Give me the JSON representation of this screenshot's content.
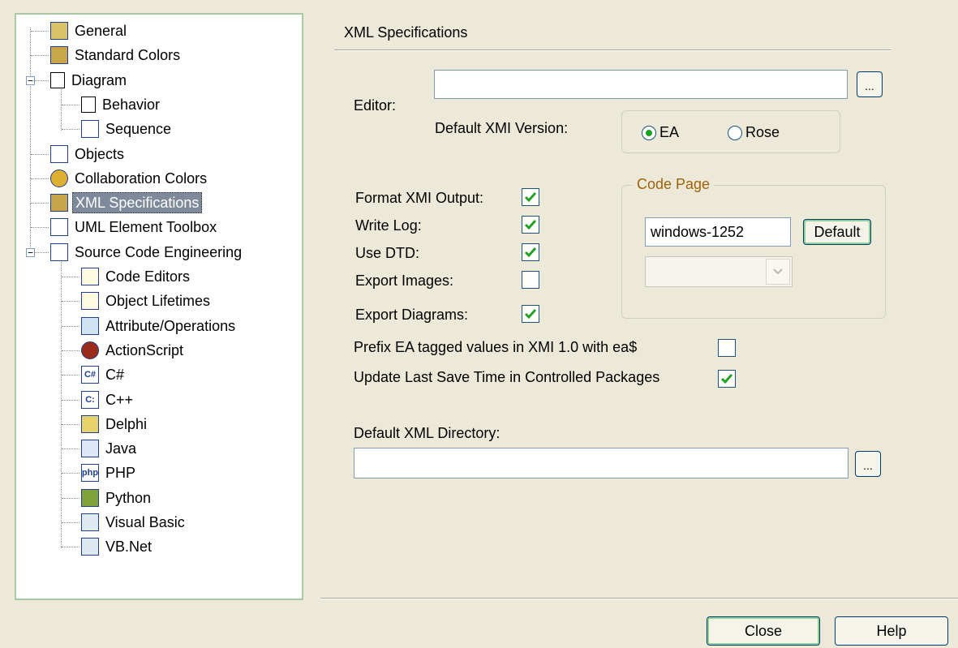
{
  "tree": {
    "items": [
      {
        "label": "General",
        "icon": "general-icon"
      },
      {
        "label": "Standard Colors",
        "icon": "paint-brush-icon"
      },
      {
        "label": "Diagram",
        "icon": "page-icon",
        "expander": "−"
      },
      {
        "label": "Behavior",
        "icon": "page-icon"
      },
      {
        "label": "Sequence",
        "icon": "sequence-icon"
      },
      {
        "label": "Objects",
        "icon": "objects-icon"
      },
      {
        "label": "Collaboration Colors",
        "icon": "collaboration-icon"
      },
      {
        "label": "XML Specifications",
        "icon": "xml-icon",
        "selected": true
      },
      {
        "label": "UML Element Toolbox",
        "icon": "toolbox-icon"
      },
      {
        "label": "Source Code Engineering",
        "icon": "source-code-icon",
        "expander": "−"
      },
      {
        "label": "Code Editors",
        "icon": "code-editor-icon"
      },
      {
        "label": "Object Lifetimes",
        "icon": "code-editor-icon"
      },
      {
        "label": "Attribute/Operations",
        "icon": "attribute-icon"
      },
      {
        "label": "ActionScript",
        "icon": "actionscript-icon"
      },
      {
        "label": "C#",
        "icon": "csharp-icon",
        "glyph": "C#"
      },
      {
        "label": "C++",
        "icon": "cpp-icon",
        "glyph": "C:"
      },
      {
        "label": "Delphi",
        "icon": "delphi-icon"
      },
      {
        "label": "Java",
        "icon": "java-icon"
      },
      {
        "label": "PHP",
        "icon": "php-icon",
        "glyph": "php"
      },
      {
        "label": "Python",
        "icon": "python-icon"
      },
      {
        "label": "Visual Basic",
        "icon": "visual-basic-icon"
      },
      {
        "label": "VB.Net",
        "icon": "vbnet-icon"
      }
    ]
  },
  "panel": {
    "title": "XML Specifications",
    "editor_label": "Editor:",
    "editor_value": "",
    "browse_label": "...",
    "xmi_version_label": "Default XMI Version:",
    "xmi_options": [
      {
        "label": "EA",
        "selected": true
      },
      {
        "label": "Rose",
        "selected": false
      }
    ],
    "checkboxes": [
      {
        "label": "Format XMI Output:",
        "checked": true
      },
      {
        "label": "Write Log:",
        "checked": true
      },
      {
        "label": "Use DTD:",
        "checked": true
      },
      {
        "label": "Export Images:",
        "checked": false
      },
      {
        "label": "Export Diagrams:",
        "checked": true
      }
    ],
    "prefix_label": "Prefix EA tagged values in XMI 1.0 with ea$",
    "prefix_checked": false,
    "update_label": "Update Last Save Time in Controlled Packages",
    "update_checked": true,
    "code_page": {
      "title": "Code Page",
      "value": "windows-1252",
      "default_button": "Default",
      "combo_value": ""
    },
    "xml_dir_label": "Default XML Directory:",
    "xml_dir_value": "",
    "xml_dir_browse": "..."
  },
  "footer": {
    "close_label": "Close",
    "help_label": "Help"
  },
  "colors": {
    "dialog_bg": "#ece9d8",
    "selection_bg": "#7e8a9c",
    "check_green": "#21a121",
    "code_page_title": "#a0620a"
  }
}
